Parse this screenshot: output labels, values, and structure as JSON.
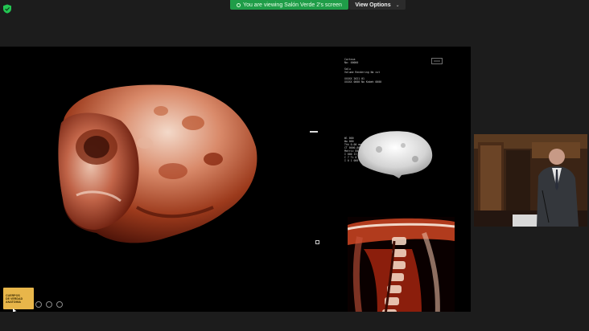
{
  "banner": {
    "viewing_text": "You are viewing Salón Verde 2's screen",
    "view_options_label": "View Options"
  },
  "icons": {
    "security": "shield-check-icon",
    "view_options_chevron": "chevron-down-icon"
  },
  "colors": {
    "banner_green": "#1f9d48",
    "security_green": "#23c552",
    "screen_background": "#000000",
    "app_background": "#1c1c1c",
    "logo_gold": "#e8b64a"
  },
  "presentation": {
    "ct_header_text": "Corteza\nNo: 00000\n\nSalu\nVolume Rendering No cut",
    "ct_side_text": "XXXXX 2021 01\nXXXXX 0000 No Kabeh 0000",
    "ct_params_text": "Wl 000\nWw 000\nThk 0.00 mm\nCT 0000,00 Mm Spectrum\nMatriz 000 x 000\nI 000 II 000\nC 7 Ti 0 0\nI 0 1 000"
  },
  "logo": {
    "line1": "CUERPOS",
    "line2": "DE VERDAD",
    "line3": "ANATOMIA"
  }
}
